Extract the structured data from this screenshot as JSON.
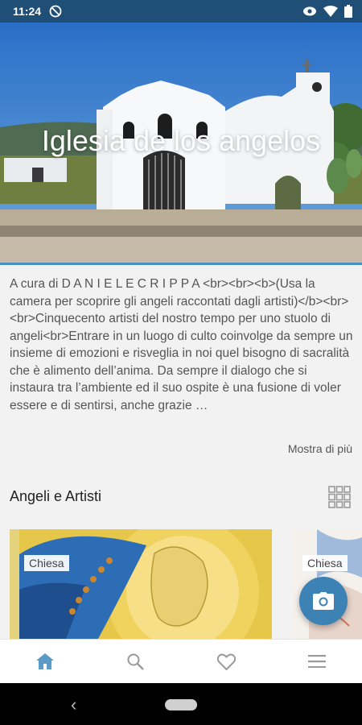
{
  "status_bar": {
    "time": "11:24"
  },
  "hero": {
    "title": "Iglesia de los angelos"
  },
  "description": {
    "text": "A cura di D A N I E L E C R I P P A <br><br><b>(Usa la camera per scoprire gli angeli raccontati dagli artisti)</b><br><br>Cinquecento artisti del nostro tempo per uno stuolo di angeli<br>Entrare in un luogo di culto coinvolge da sempre un insieme di emozioni e risveglia in noi quel bisogno di sacralità che è alimento dell’anima. Da sempre il dialogo che si instaura tra l’ambiente ed il suo ospite è una fusione di voler essere e di sentirsi, anche grazie …",
    "more_label": "Mostra di più"
  },
  "section": {
    "title": "Angeli e Artisti"
  },
  "cards": [
    {
      "badge": "Chiesa"
    },
    {
      "badge": "Chiesa"
    }
  ],
  "bottom_nav": {
    "items": [
      "home-icon",
      "search-icon",
      "heart-icon",
      "menu-icon"
    ],
    "active_color": "#5b9bc8",
    "inactive_color": "#9a9a9a"
  },
  "colors": {
    "status_bar": "#1f4f77",
    "accent": "#3d82b5"
  }
}
